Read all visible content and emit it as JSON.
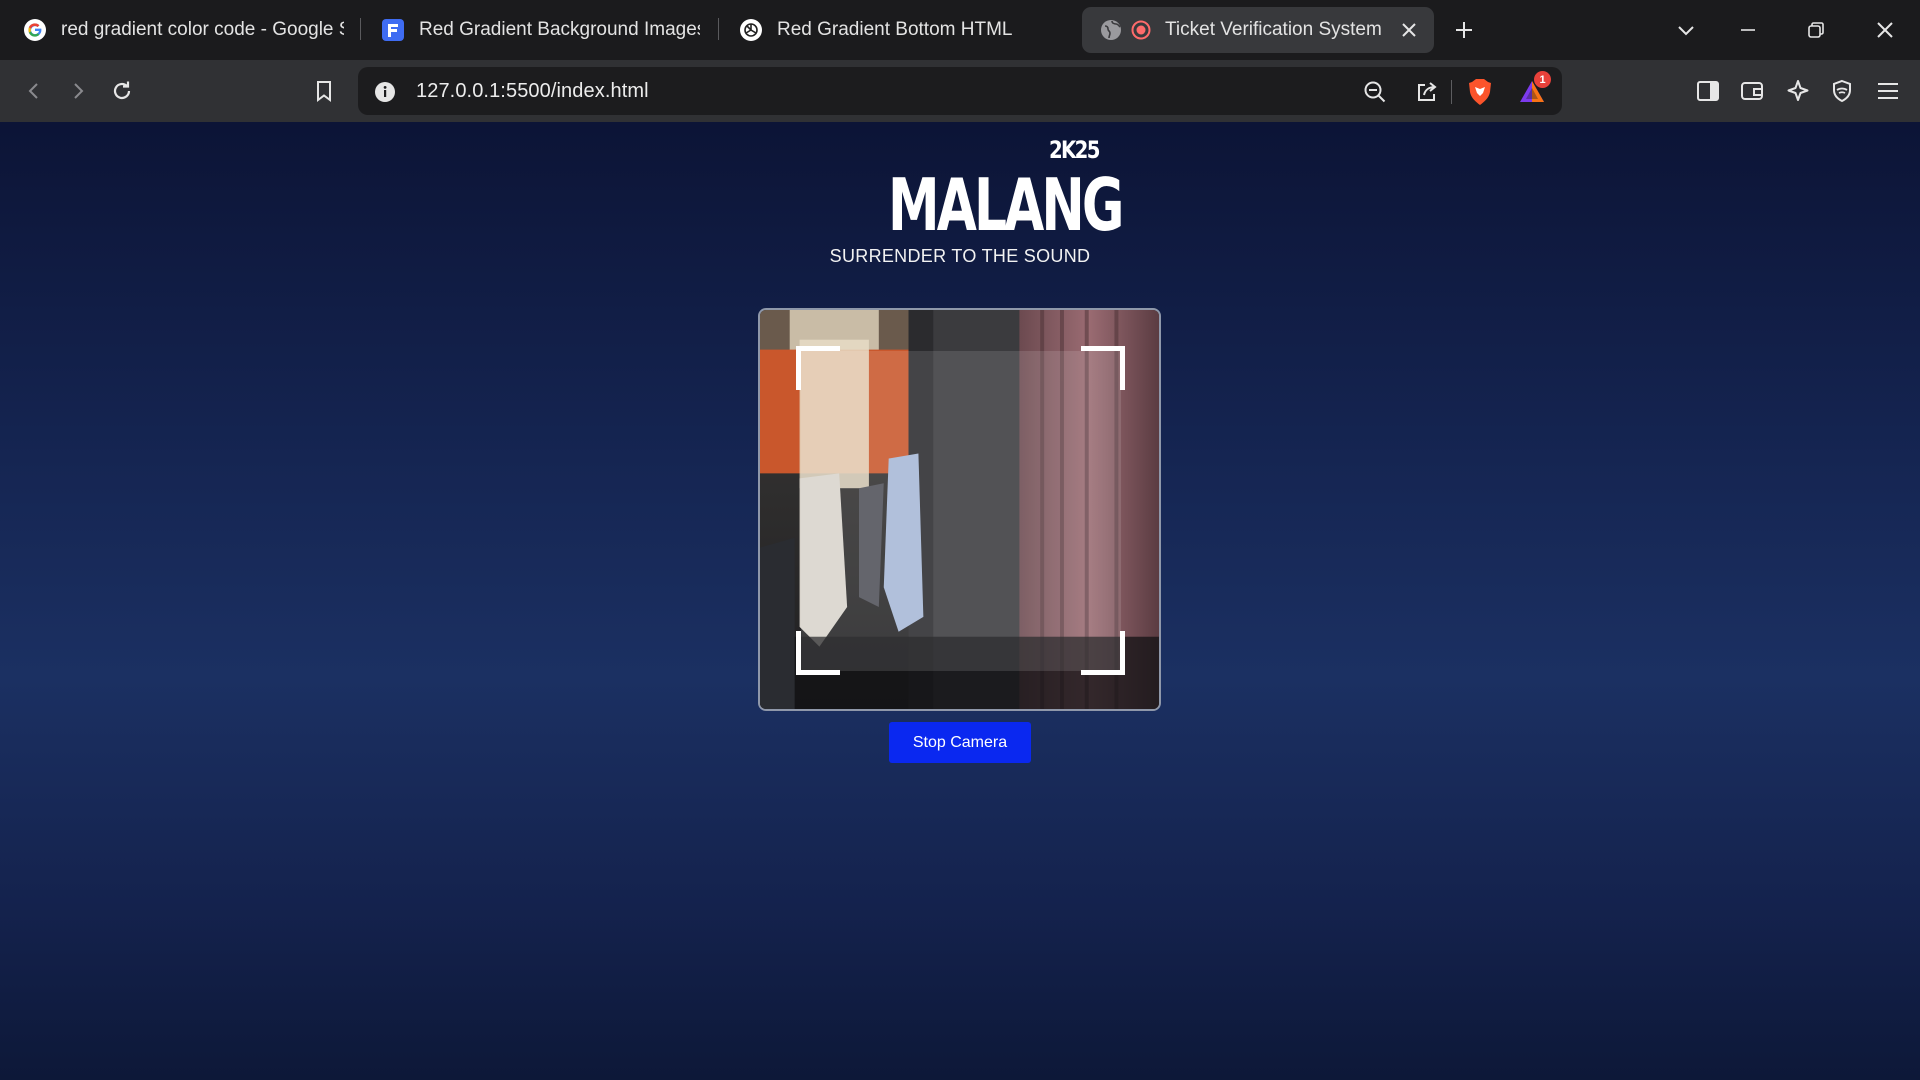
{
  "tabs": [
    {
      "title": "red gradient color code - Google Se",
      "favicon": "google-icon"
    },
    {
      "title": "Red Gradient Background Images -",
      "favicon": "freepik-icon"
    },
    {
      "title": "Red Gradient Bottom HTML",
      "favicon": "openai-icon"
    },
    {
      "title": "Ticket Verification System",
      "favicon": "globe-icon",
      "recording": true,
      "active": true
    }
  ],
  "address_bar": {
    "url": "127.0.0.1:5500/index.html"
  },
  "extensions": {
    "rewards_badge": "1"
  },
  "page": {
    "year_badge": "2K25",
    "title": "MALANG",
    "tagline": "SURRENDER TO THE SOUND",
    "stop_button": "Stop Camera"
  },
  "colors": {
    "button_bg": "#0a28f0",
    "page_gradient_top": "#0c1436",
    "page_gradient_mid": "#1b3062"
  }
}
